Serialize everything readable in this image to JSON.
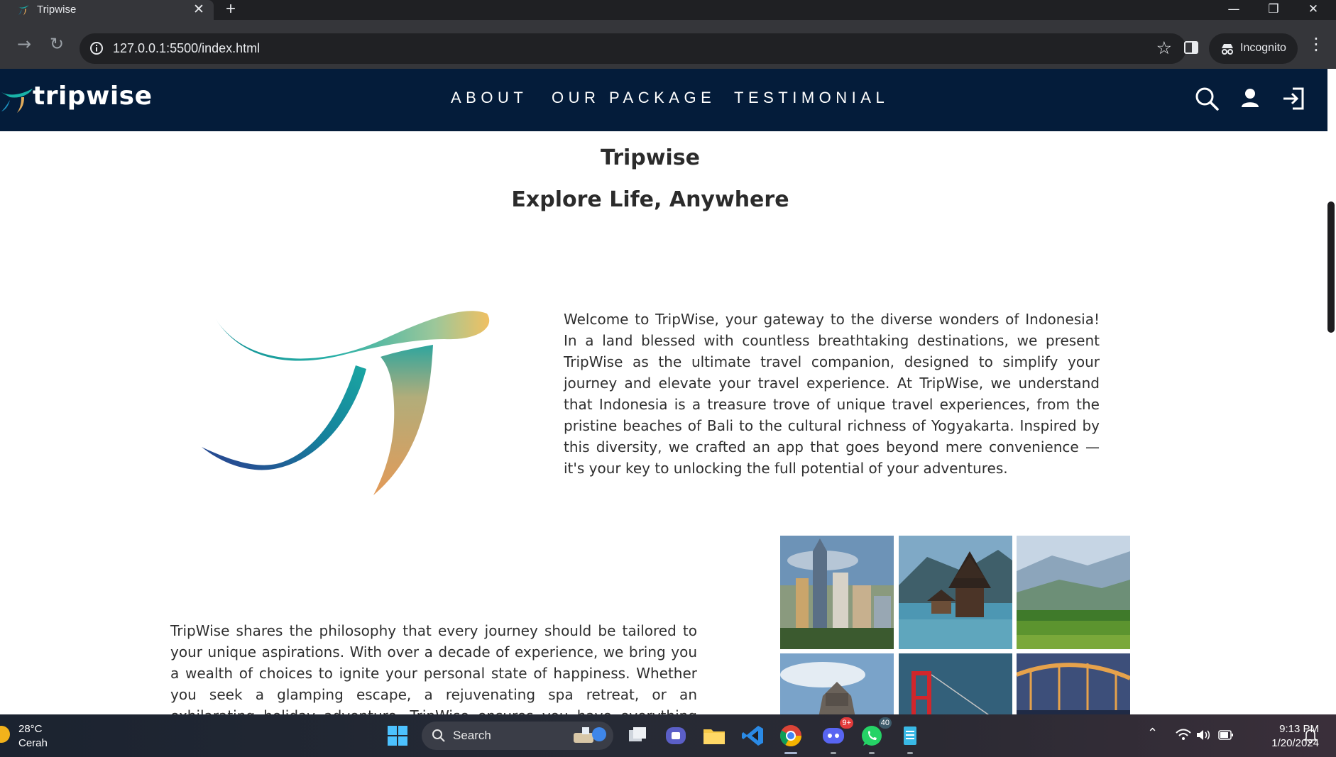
{
  "browser": {
    "tab_title": "Tripwise",
    "new_tab_label": "+",
    "close_tab_label": "✕",
    "url": "127.0.0.1:5500/index.html",
    "incognito_label": "Incognito"
  },
  "header": {
    "brand": "tripwise",
    "nav": [
      "ABOUT",
      "OUR PACKAGE",
      "TESTIMONIAL"
    ],
    "colors": {
      "background": "#041c3a",
      "text": "#ffffff"
    }
  },
  "main": {
    "title": "Tripwise",
    "subtitle": "Explore Life, Anywhere",
    "paragraph_1": "Welcome to TripWise, your gateway to the diverse wonders of Indonesia! In a land blessed with countless breathtaking destinations, we present TripWise as the ultimate travel companion, designed to simplify your journey and elevate your travel experience. At TripWise, we understand that Indonesia is a treasure trove of unique travel experiences, from the pristine beaches of Bali to the cultural richness of Yogyakarta. Inspired by this diversity, we crafted an app that goes beyond mere convenience — it's your key to unlocking the full potential of your adventures.",
    "paragraph_2": "TripWise shares the philosophy that every journey should be tailored to your unique aspirations. With over a decade of experience, we bring you a wealth of choices to ignite your personal state of happiness. Whether you seek a glamping escape, a rejuvenating spa retreat, or an exhilarating holiday adventure, TripWise ensures you have everything you need for both domestic and international travel."
  },
  "taskbar": {
    "weather_temp": "28°C",
    "weather_condition": "Cerah",
    "search_label": "Search",
    "discord_badge": "9+",
    "whatsapp_badge": "40",
    "time": "9:13 PM",
    "date": "1/20/2024"
  }
}
